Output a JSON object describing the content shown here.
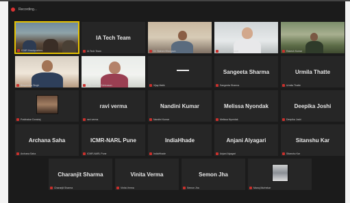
{
  "window": {
    "recording_label": "Recording..."
  },
  "tiles": [
    {
      "name": "",
      "sub": "ICMR Headquarters",
      "kind": "video"
    },
    {
      "name": "IA Tech Team",
      "sub": "IA Tech Team",
      "kind": "name"
    },
    {
      "name": "",
      "sub": "Dr. Balram Bhargava",
      "kind": "video"
    },
    {
      "name": "",
      "sub": "Anand Kr Jaiswal",
      "kind": "video"
    },
    {
      "name": "",
      "sub": "Rakesh Kumar",
      "kind": "video"
    },
    {
      "name": "",
      "sub": "Bhupendra Singh",
      "kind": "video"
    },
    {
      "name": "",
      "sub": "Dr. Sandhya Srinivasan",
      "kind": "video"
    },
    {
      "name": "",
      "sub": "Vijay Malik",
      "kind": "screen"
    },
    {
      "name": "Sangeeta Sharma",
      "sub": "Sangeeta Sharma",
      "kind": "name"
    },
    {
      "name": "Urmila Thatte",
      "sub": "Urmila Thatte",
      "kind": "name"
    },
    {
      "name": "",
      "sub": "Prabhakar Dorairaj",
      "kind": "photo"
    },
    {
      "name": "ravi verma",
      "sub": "ravi verma",
      "kind": "name"
    },
    {
      "name": "Nandini Kumar",
      "sub": "Nandini Kumar",
      "kind": "name"
    },
    {
      "name": "Melissa Nyondak",
      "sub": "Melissa Nyondak",
      "kind": "name"
    },
    {
      "name": "Deepika Joshi",
      "sub": "Deepika Joshi",
      "kind": "name"
    },
    {
      "name": "Archana Saha",
      "sub": "Archana Saha",
      "kind": "name"
    },
    {
      "name": "ICMR-NARL Pune",
      "sub": "ICMR-NARL Pune",
      "kind": "name"
    },
    {
      "name": "IndiaHhade",
      "sub": "IndiaHhade",
      "kind": "name"
    },
    {
      "name": "Anjani Alyagari",
      "sub": "Anjani Alyagari",
      "kind": "name"
    },
    {
      "name": "Sitanshu Kar",
      "sub": "Sitanshu Kar",
      "kind": "name"
    },
    {
      "name": "Charanjit Sharma",
      "sub": "Charanjit Sharma",
      "kind": "name"
    },
    {
      "name": "Vinita Verma",
      "sub": "Vinita Verma",
      "kind": "name"
    },
    {
      "name": "Semon Jha",
      "sub": "Semon Jha",
      "kind": "name"
    },
    {
      "name": "",
      "sub": "Manoj Murhekar",
      "kind": "photo"
    }
  ]
}
